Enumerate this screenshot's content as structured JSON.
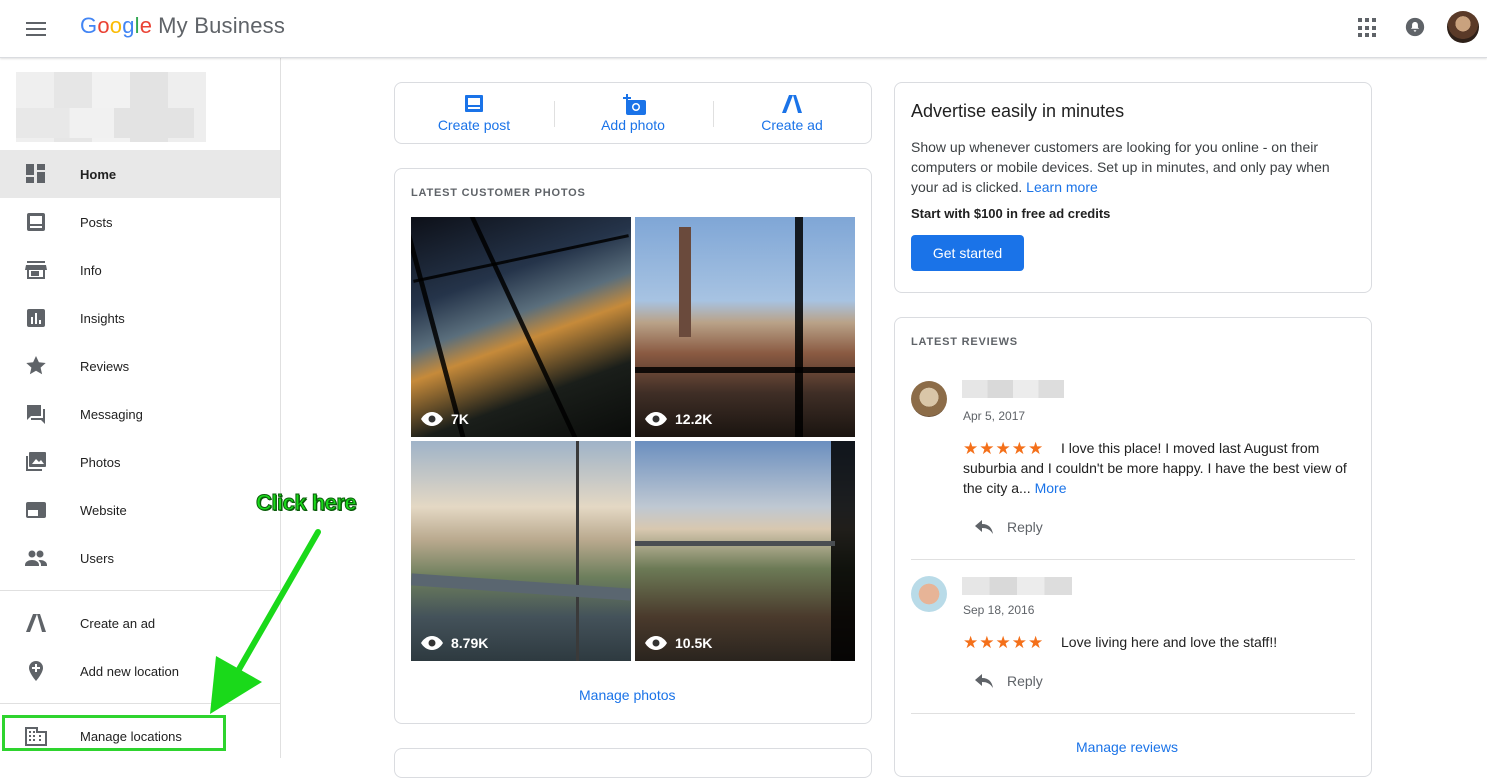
{
  "header": {
    "logo_letters": [
      "G",
      "o",
      "o",
      "g",
      "l",
      "e"
    ],
    "product": "My Business"
  },
  "sidebar": {
    "items": [
      {
        "label": "Home",
        "icon": "dashboard-icon"
      },
      {
        "label": "Posts",
        "icon": "posts-icon"
      },
      {
        "label": "Info",
        "icon": "storefront-icon"
      },
      {
        "label": "Insights",
        "icon": "insights-icon"
      },
      {
        "label": "Reviews",
        "icon": "star-icon"
      },
      {
        "label": "Messaging",
        "icon": "messaging-icon"
      },
      {
        "label": "Photos",
        "icon": "photos-icon"
      },
      {
        "label": "Website",
        "icon": "website-icon"
      },
      {
        "label": "Users",
        "icon": "users-icon"
      },
      {
        "label": "Create an ad",
        "icon": "ads-icon"
      },
      {
        "label": "Add new location",
        "icon": "add-location-icon"
      },
      {
        "label": "Manage locations",
        "icon": "building-icon"
      }
    ]
  },
  "annotation": {
    "text": "Click here",
    "color": "#1ad91a"
  },
  "actions": {
    "create_post": "Create post",
    "add_photo": "Add photo",
    "create_ad": "Create ad"
  },
  "photos": {
    "title": "LATEST CUSTOMER PHOTOS",
    "items": [
      {
        "views": "7K"
      },
      {
        "views": "12.2K"
      },
      {
        "views": "8.79K"
      },
      {
        "views": "10.5K"
      }
    ],
    "manage": "Manage photos"
  },
  "ad": {
    "title": "Advertise easily in minutes",
    "body": "Show up whenever customers are looking for you online - on their computers or mobile devices. Set up in minutes, and only pay when your ad is clicked.",
    "learn_more": "Learn more",
    "credits": "Start with $100 in free ad credits",
    "button": "Get started"
  },
  "reviews": {
    "title": "LATEST REVIEWS",
    "items": [
      {
        "date": "Apr 5, 2017",
        "stars": "★★★★★",
        "text": "I love this place! I moved last August from suburbia and I couldn't be more happy. I have the best view of the city a...",
        "more": "More",
        "reply": "Reply"
      },
      {
        "date": "Sep 18, 2016",
        "stars": "★★★★★",
        "text": "Love living here and love the staff!!",
        "reply": "Reply"
      }
    ],
    "manage": "Manage reviews"
  },
  "colors": {
    "accent": "#1a73e8",
    "star": "#f4701a",
    "highlight": "#2ed42e"
  }
}
